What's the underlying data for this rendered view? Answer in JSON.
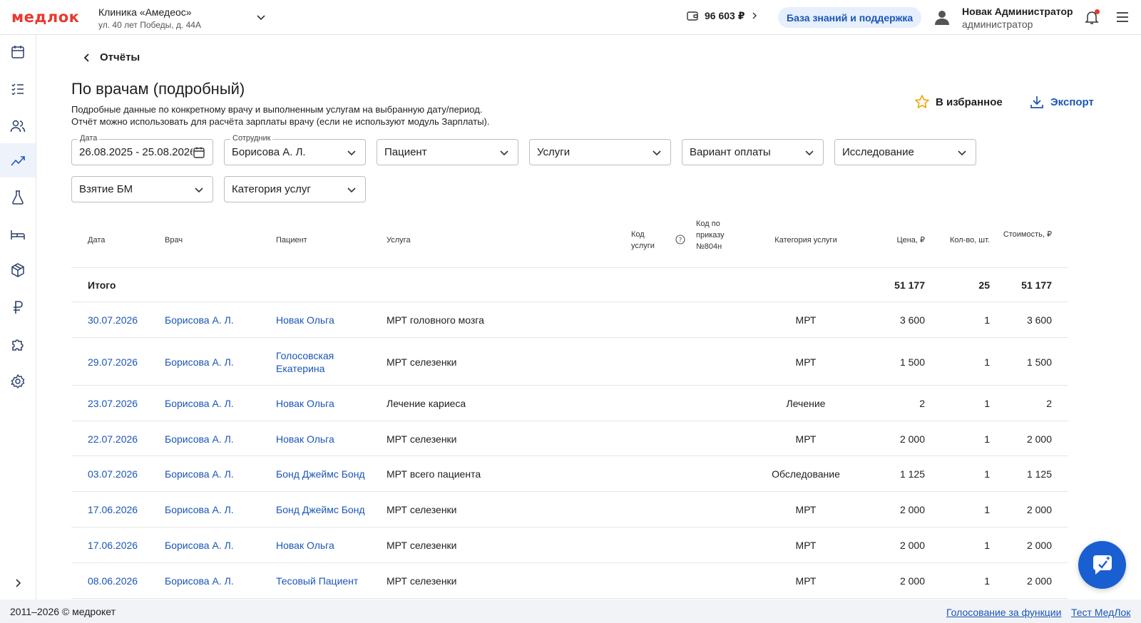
{
  "header": {
    "logo": "медлок",
    "clinic_name": "Клиника «Амедеос»",
    "clinic_address": "ул. 40 лет Победы, д. 44А",
    "balance": "96 603 ₽",
    "knowledge_base": "База знаний и поддержка",
    "user_name": "Новак Администратор",
    "user_role": "администратор"
  },
  "sidebar": {
    "items": [
      "calendar-icon",
      "checklist-icon",
      "users-icon",
      "reports-chart-icon",
      "lab-flask-icon",
      "bed-icon",
      "box-icon",
      "ruble-icon",
      "puzzle-icon",
      "settings-gear-icon"
    ],
    "active_index": 3
  },
  "page": {
    "back_label": "Отчёты",
    "title": "По врачам (подробный)",
    "desc_line1": "Подробные данные по конкретному врачу и выполненным услугам на выбранную дату/период.",
    "desc_line2": "Отчёт можно использовать для расчёта зарплаты врачу (если не используют модуль Зарплаты).",
    "favorite": "В избранное",
    "export": "Экспорт"
  },
  "filters": {
    "date_legend": "Дата",
    "date_value": "26.08.2025 - 25.08.2026",
    "employee_legend": "Сотрудник",
    "employee_value": "Борисова А. Л.",
    "patient": "Пациент",
    "services": "Услуги",
    "payment": "Вариант оплаты",
    "research": "Исследование",
    "biomaterial": "Взятие БМ",
    "service_category": "Категория услуг"
  },
  "table": {
    "headers": {
      "date": "Дата",
      "doctor": "Врач",
      "patient": "Пациент",
      "service": "Услуга",
      "code": "Код услуги",
      "code804": "Код по приказу №804н",
      "category": "Категория услуги",
      "price": "Цена, ₽",
      "qty": "Кол-во, шт.",
      "cost": "Стоимость, ₽"
    },
    "total": {
      "label": "Итого",
      "price": "51 177",
      "qty": "25",
      "cost": "51 177"
    },
    "rows": [
      {
        "date": "30.07.2026",
        "doctor": "Борисова А. Л.",
        "patient": "Новак Ольга",
        "service": "МРТ головного мозга",
        "category": "МРТ",
        "price": "3 600",
        "qty": "1",
        "cost": "3 600"
      },
      {
        "date": "29.07.2026",
        "doctor": "Борисова А. Л.",
        "patient": "Голосовская Екатерина",
        "service": "МРТ селезенки",
        "category": "МРТ",
        "price": "1 500",
        "qty": "1",
        "cost": "1 500"
      },
      {
        "date": "23.07.2026",
        "doctor": "Борисова А. Л.",
        "patient": "Новак Ольга",
        "service": "Лечение кариеса",
        "category": "Лечение",
        "price": "2",
        "qty": "1",
        "cost": "2"
      },
      {
        "date": "22.07.2026",
        "doctor": "Борисова А. Л.",
        "patient": "Новак Ольга",
        "service": "МРТ селезенки",
        "category": "МРТ",
        "price": "2 000",
        "qty": "1",
        "cost": "2 000"
      },
      {
        "date": "03.07.2026",
        "doctor": "Борисова А. Л.",
        "patient": "Бонд Джеймс Бонд",
        "service": "МРТ всего пациента",
        "category": "Обследование",
        "price": "1 125",
        "qty": "1",
        "cost": "1 125"
      },
      {
        "date": "17.06.2026",
        "doctor": "Борисова А. Л.",
        "patient": "Бонд Джеймс Бонд",
        "service": "МРТ селезенки",
        "category": "МРТ",
        "price": "2 000",
        "qty": "1",
        "cost": "2 000"
      },
      {
        "date": "17.06.2026",
        "doctor": "Борисова А. Л.",
        "patient": "Новак Ольга",
        "service": "МРТ селезенки",
        "category": "МРТ",
        "price": "2 000",
        "qty": "1",
        "cost": "2 000"
      },
      {
        "date": "08.06.2026",
        "doctor": "Борисова А. Л.",
        "patient": "Тесовый Пациент",
        "service": "МРТ селезенки",
        "category": "МРТ",
        "price": "2 000",
        "qty": "1",
        "cost": "2 000"
      }
    ]
  },
  "footer": {
    "copyright": "2011–2026 © медрокет",
    "link1": "Голосование за функции",
    "link2": "Тест МедЛок"
  },
  "colors": {
    "accent": "#1a56b8",
    "brand": "#e8392f",
    "fab": "#1a5fd1"
  }
}
